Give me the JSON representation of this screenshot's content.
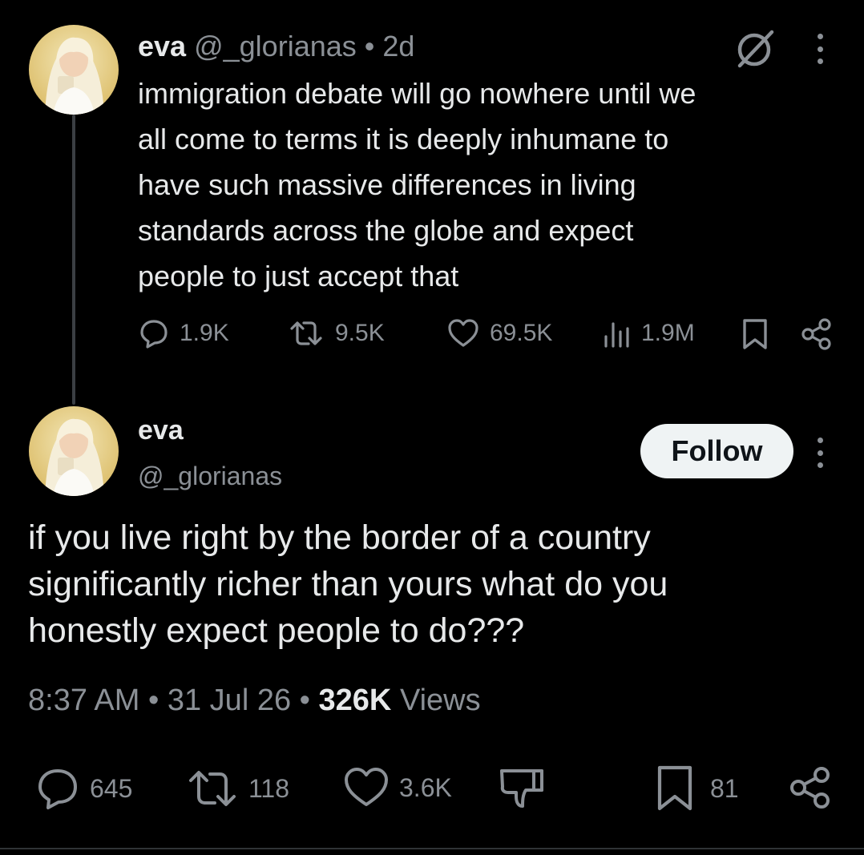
{
  "parent_tweet": {
    "display_name": "eva",
    "handle": "@_glorianas",
    "separator": "•",
    "age": "2d",
    "text_lines": [
      "immigration debate will go nowhere until we",
      "all come to terms it is deeply inhumane to",
      "have such massive differences in living",
      "standards across the globe and expect",
      "people to just accept that"
    ],
    "actions": {
      "replies": "1.9K",
      "reposts": "9.5K",
      "likes": "69.5K",
      "views": "1.9M"
    }
  },
  "main_tweet": {
    "display_name": "eva",
    "handle": "@_glorianas",
    "follow_label": "Follow",
    "text_lines": [
      "if you live right by the border of a country",
      "significantly richer than yours what do you",
      "honestly expect people to do???"
    ],
    "time": "8:37 AM",
    "date": "31 Jul 26",
    "separator": "•",
    "views_count": "326K",
    "views_label": "Views",
    "actions": {
      "replies": "645",
      "reposts": "118",
      "likes": "3.6K",
      "bookmarks": "81"
    }
  },
  "icons": {
    "reply": "reply-icon",
    "repost": "repost-icon",
    "like": "heart-icon",
    "views": "analytics-icon",
    "bookmark": "bookmark-icon",
    "share": "share-icon",
    "dislike": "thumbs-down-icon",
    "grok": "grok-icon",
    "more": "more-vertical-icon"
  },
  "colors": {
    "background": "#000000",
    "text_primary": "#e7e9ea",
    "text_muted": "#8b9096",
    "follow_button_bg": "#eff3f4",
    "thread_line": "#3b3f43"
  }
}
